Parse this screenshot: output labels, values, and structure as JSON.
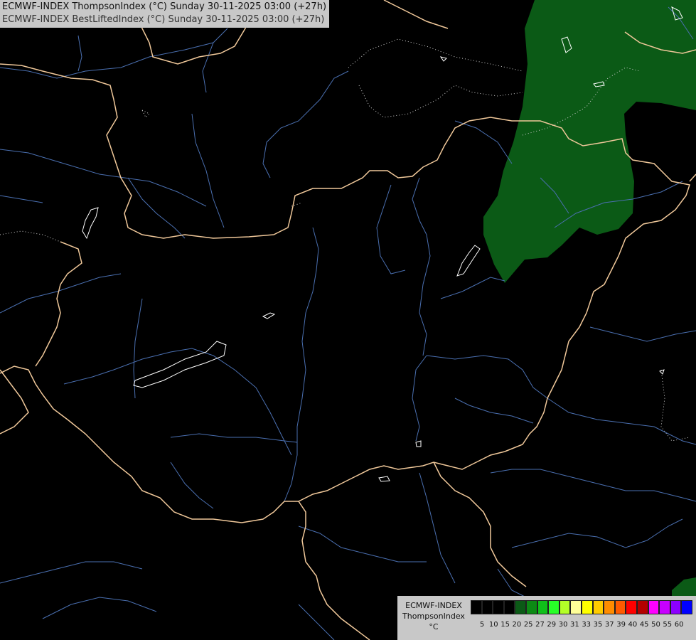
{
  "header": {
    "line1": "ECMWF-INDEX ThompsonIndex (°C) Sunday 30-11-2025 03:00 (+27h)",
    "line2": "ECMWF-INDEX BestLiftedIndex (°C) Sunday 30-11-2025 03:00 (+27h)"
  },
  "colors": {
    "background": "#000000",
    "border_line": "#f0c89a",
    "river_line": "#4a6fb0",
    "contour_line": "#ffffff",
    "field_green": "#0b5a16"
  },
  "legend": {
    "line1": "ECMWF-INDEX",
    "line2": "ThompsonIndex",
    "line3": "°C",
    "scale_colors": [
      "#000000",
      "#000000",
      "#000000",
      "#000000",
      "#0b5a16",
      "#0c8a14",
      "#10c01a",
      "#28ff28",
      "#b4ff28",
      "#ffff99",
      "#ffff00",
      "#ffcc00",
      "#ff8c00",
      "#ff5a00",
      "#ff0000",
      "#b40000",
      "#ff00ff",
      "#c800ff",
      "#8c00ff",
      "#0000ff"
    ],
    "tick_labels": [
      "5",
      "10",
      "15",
      "20",
      "25",
      "27",
      "29",
      "30",
      "31",
      "33",
      "35",
      "37",
      "39",
      "40",
      "45",
      "50",
      "55",
      "60"
    ]
  }
}
